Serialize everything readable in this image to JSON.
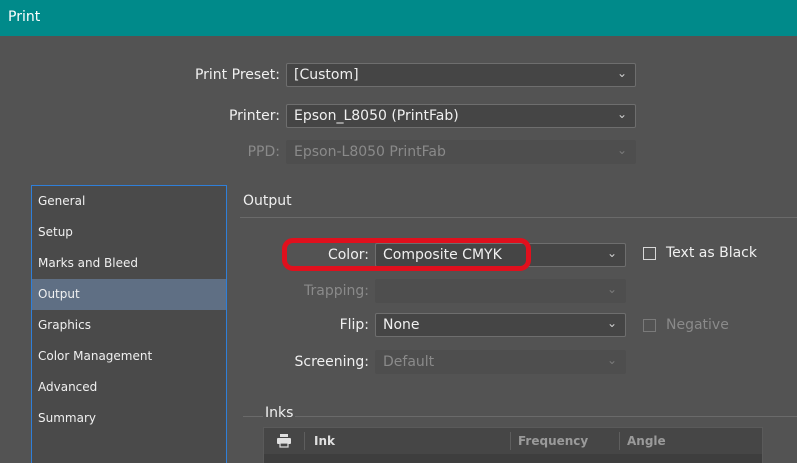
{
  "window": {
    "title": "Print"
  },
  "preset": {
    "label": "Print Preset:",
    "value": "[Custom]"
  },
  "printer": {
    "label": "Printer:",
    "value": "Epson_L8050 (PrintFab)"
  },
  "ppd": {
    "label": "PPD:",
    "value": "Epson-L8050 PrintFab"
  },
  "sidebar": {
    "items": [
      {
        "label": "General"
      },
      {
        "label": "Setup"
      },
      {
        "label": "Marks and Bleed"
      },
      {
        "label": "Output"
      },
      {
        "label": "Graphics"
      },
      {
        "label": "Color Management"
      },
      {
        "label": "Advanced"
      },
      {
        "label": "Summary"
      }
    ],
    "active": "Output"
  },
  "output": {
    "section_title": "Output",
    "color": {
      "label": "Color:",
      "value": "Composite CMYK"
    },
    "text_as_black": {
      "label": "Text as Black",
      "checked": false
    },
    "trapping": {
      "label": "Trapping:",
      "value": ""
    },
    "flip": {
      "label": "Flip:",
      "value": "None"
    },
    "negative": {
      "label": "Negative",
      "checked": false
    },
    "screening": {
      "label": "Screening:",
      "value": "Default"
    }
  },
  "inks": {
    "title": "Inks",
    "columns": [
      "Ink",
      "Frequency",
      "Angle"
    ],
    "printer_icon": "printer-icon"
  },
  "colors": {
    "titlebar": "#008a8a",
    "background": "#535353",
    "sidebar_active": "#5f6f84",
    "highlight": "#e0101d",
    "sidebar_border": "#2f7fd9"
  }
}
